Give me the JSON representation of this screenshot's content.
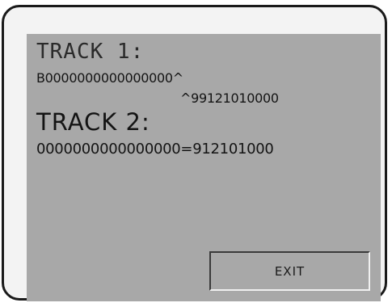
{
  "track1": {
    "label": "TRACK  1:",
    "data_line1": "B0000000000000000^",
    "data_line2": "^99121010000"
  },
  "track2": {
    "label": "TRACK  2:",
    "data": "0000000000000000=912101000"
  },
  "exit_button": {
    "label": "EXIT"
  },
  "colors": {
    "screen_background": "#a8a8a8",
    "text": "#141414",
    "bezel_border": "#1a1a1a"
  }
}
